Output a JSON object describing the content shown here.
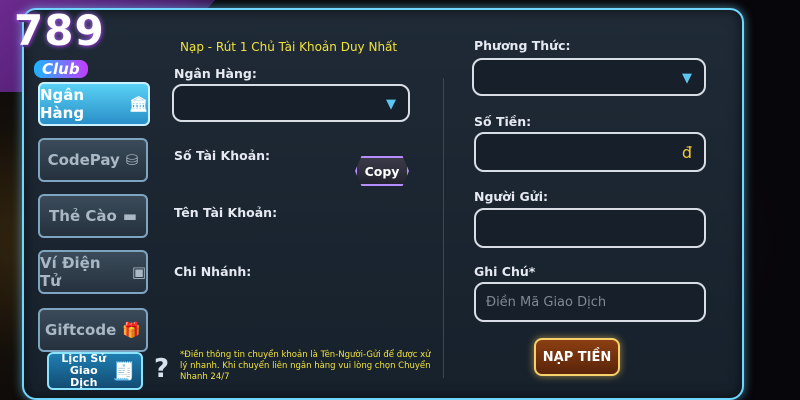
{
  "logo": {
    "text": "789",
    "sub": "Club"
  },
  "sidebar": {
    "items": [
      {
        "label": "Ngân Hàng",
        "icon": "bank-icon",
        "glyph": "🏛",
        "active": true
      },
      {
        "label": "CodePay",
        "icon": "coins-icon",
        "glyph": "⛁"
      },
      {
        "label": "Thẻ Cào",
        "icon": "card-icon",
        "glyph": "▬"
      },
      {
        "label": "Ví Điện Tử",
        "icon": "wallet-icon",
        "glyph": "▣"
      },
      {
        "label": "Giftcode",
        "icon": "gift-icon",
        "glyph": "🎁"
      }
    ],
    "history": {
      "line1": "Lịch Sử",
      "line2": "Giao Dịch",
      "icon": "receipt-icon",
      "glyph": "🧾"
    }
  },
  "form": {
    "notice": "Nạp - Rút 1 Chủ Tài Khoản Duy Nhất",
    "bank_label": "Ngân Hàng:",
    "account_number_label": "Số Tài Khoản:",
    "copy_label": "Copy",
    "account_name_label": "Tên Tài Khoản:",
    "branch_label": "Chi Nhánh:",
    "method_label": "Phương Thức:",
    "amount_label": "Số Tiền:",
    "currency_symbol": "đ",
    "sender_label": "Người Gửi:",
    "note_label": "Ghi Chú*",
    "note_placeholder": "Điền Mã Giao Dịch",
    "deposit_label": "NẠP TIỀN",
    "help_glyph": "?",
    "footnote": "*Điền thông tin chuyển khoản là Tên-Người-Gửi để được xử lý nhanh. Khi chuyển liên ngân hàng vui lòng chọn Chuyển Nhanh 24/7"
  },
  "colors": {
    "accent": "#6fd6ff",
    "notice": "#f1e33b",
    "deposit": "#f6d06a"
  }
}
